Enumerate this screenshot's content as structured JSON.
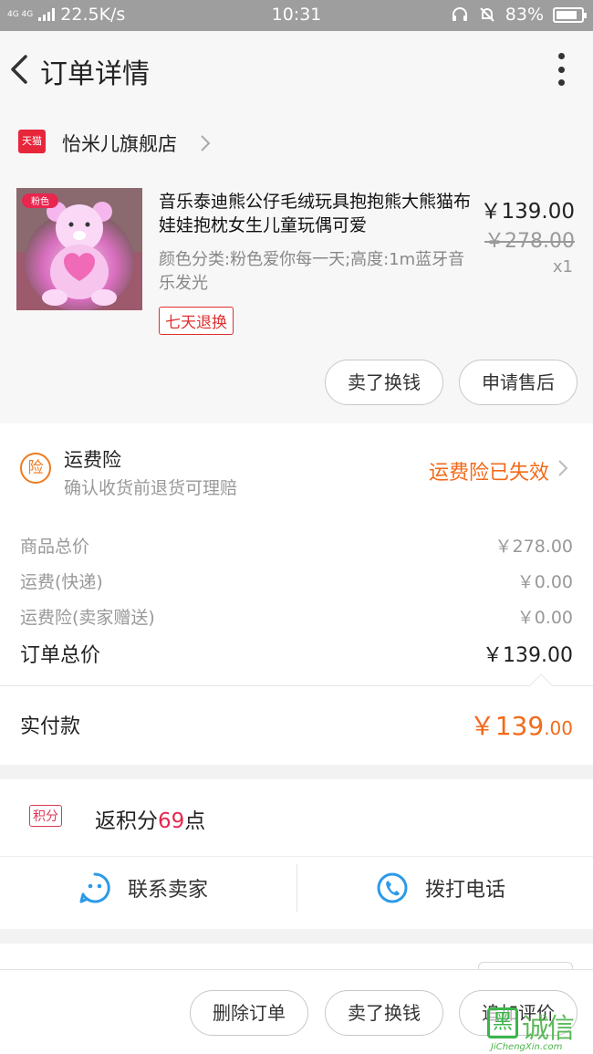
{
  "status_bar": {
    "network": "4G 4G",
    "speed": "22.5K/s",
    "time": "10:31",
    "battery": "83%",
    "battery_level": 0.83
  },
  "header": {
    "title": "订单详情"
  },
  "shop": {
    "badge": "天猫",
    "name": "怡米儿旗舰店"
  },
  "product": {
    "image_tag": "粉色",
    "title": "音乐泰迪熊公仔毛绒玩具抱抱熊大熊猫布娃娃抱枕女生儿童玩偶可爱",
    "sku": "颜色分类:粉色爱你每一天;高度:1m蓝牙音乐发光",
    "return_tag": "七天退换",
    "price": "￥139.00",
    "original_price": "￥278.00",
    "quantity": "x1",
    "actions": [
      "卖了换钱",
      "申请售后"
    ]
  },
  "insurance": {
    "icon": "险",
    "title": "运费险",
    "subtitle": "确认收货前退货可理赔",
    "status": "运费险已失效"
  },
  "summary": {
    "rows": [
      {
        "label": "商品总价",
        "value": "￥278.00"
      },
      {
        "label": "运费(快递)",
        "value": "￥0.00"
      },
      {
        "label": "运费险(卖家赠送)",
        "value": "￥0.00"
      }
    ],
    "total_label": "订单总价",
    "total_value": "￥139.00"
  },
  "paid": {
    "label": "实付款",
    "amount_main": "￥139",
    "amount_decimal": ".00"
  },
  "points": {
    "badge": "积分",
    "prefix": "返积分",
    "value": "69",
    "suffix": "点"
  },
  "contact": {
    "seller": "联系卖家",
    "phone": "拨打电话"
  },
  "bottom_actions": [
    "删除订单",
    "卖了换钱",
    "追加评价"
  ],
  "watermark": {
    "cn": "诚信",
    "en": "JiChengXin.com",
    "mark": "黑"
  },
  "colors": {
    "accent_orange": "#f26a1a",
    "points_red": "#e8264f",
    "tag_red": "#e03030",
    "icon_blue": "#2c9ae8"
  }
}
